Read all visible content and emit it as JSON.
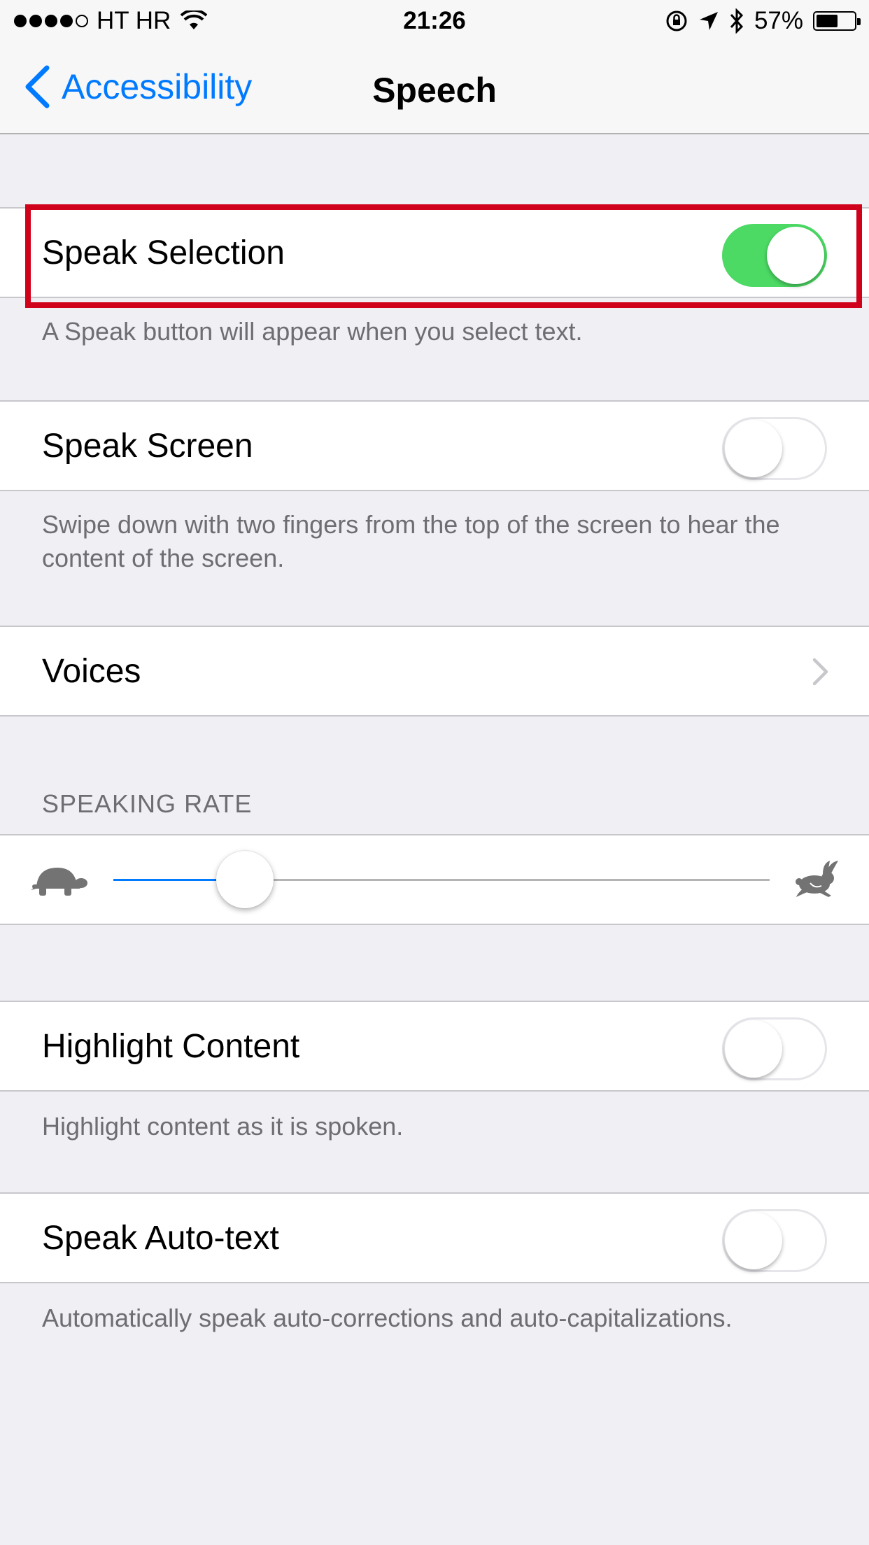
{
  "status_bar": {
    "carrier": "HT HR",
    "time": "21:26",
    "battery_percent": "57%",
    "battery_level": 0.57,
    "signal_bars_filled": 4,
    "signal_bars_total": 5,
    "icons": [
      "wifi-icon",
      "rotation-lock-icon",
      "location-arrow-icon",
      "bluetooth-icon",
      "battery-icon"
    ]
  },
  "nav": {
    "back_label": "Accessibility",
    "title": "Speech"
  },
  "speak_selection": {
    "label": "Speak Selection",
    "enabled": true,
    "footer": "A Speak button will appear when you select text."
  },
  "speak_screen": {
    "label": "Speak Screen",
    "enabled": false,
    "footer": "Swipe down with two fingers from the top of the screen to hear the content of the screen."
  },
  "voices": {
    "label": "Voices"
  },
  "speaking_rate": {
    "header": "SPEAKING RATE",
    "value": 0.2,
    "min_icon": "turtle-icon",
    "max_icon": "rabbit-icon"
  },
  "highlight_content": {
    "label": "Highlight Content",
    "enabled": false,
    "footer": "Highlight content as it is spoken."
  },
  "speak_auto_text": {
    "label": "Speak Auto-text",
    "enabled": false,
    "footer": "Automatically speak auto-corrections and auto-capitalizations."
  },
  "colors": {
    "accent": "#007aff",
    "switch_on": "#4cd964",
    "highlight_outline": "#d0021b",
    "background": "#efeff4"
  }
}
